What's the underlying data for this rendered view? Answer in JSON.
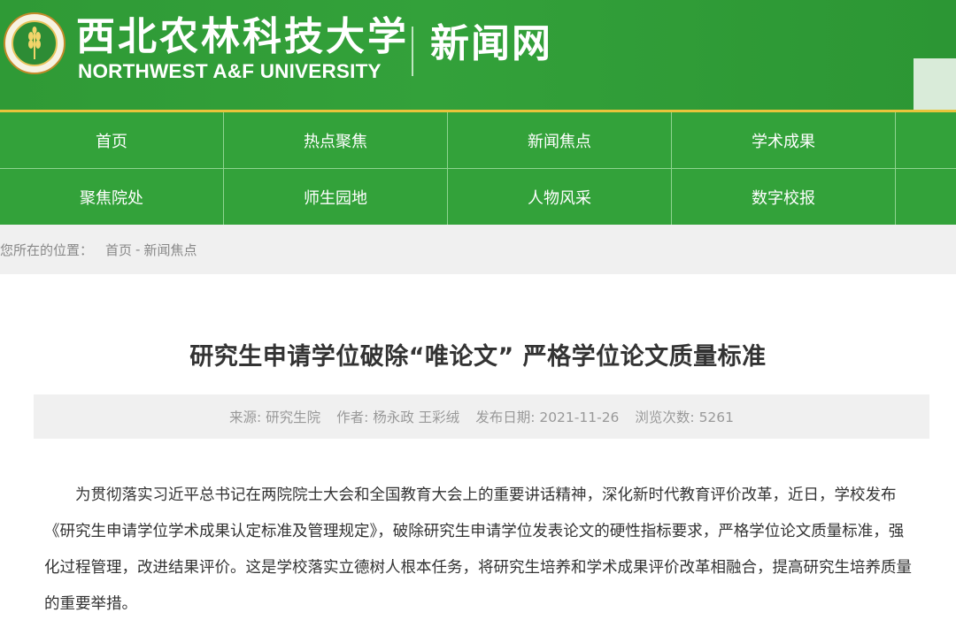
{
  "header": {
    "school_name_cn": "西北农林科技大学",
    "school_name_en": "NORTHWEST A&F UNIVERSITY",
    "site_name": "新闻网",
    "logo_icon": "university-seal-wheat",
    "colors": {
      "primary_green": "#33a23a",
      "accent_yellow": "#e9c43b"
    }
  },
  "nav": {
    "row1": [
      "首页",
      "热点聚焦",
      "新闻焦点",
      "学术成果"
    ],
    "row2": [
      "聚焦院处",
      "师生园地",
      "人物风采",
      "数字校报"
    ]
  },
  "breadcrumb": {
    "label": "您所在的位置：",
    "home": "首页",
    "separator": "-",
    "current": "新闻焦点"
  },
  "article": {
    "title": "研究生申请学位破除“唯论文” 严格学位论文质量标准",
    "meta": {
      "source": "来源: 研究生院",
      "author": "作者: 杨永政 王彩绒",
      "date": "发布日期: 2021-11-26",
      "views": "浏览次数: 5261"
    },
    "paragraph": "为贯彻落实习近平总书记在两院院士大会和全国教育大会上的重要讲话精神，深化新时代教育评价改革，近日，学校发布《研究生申请学位学术成果认定标准及管理规定》，破除研究生申请学位发表论文的硬性指标要求，严格学位论文质量标准，强化过程管理，改进结果评价。这是学校落实立德树人根本任务，将研究生培养和学术成果评价改革相融合，提高研究生培养质量的重要举措。"
  }
}
